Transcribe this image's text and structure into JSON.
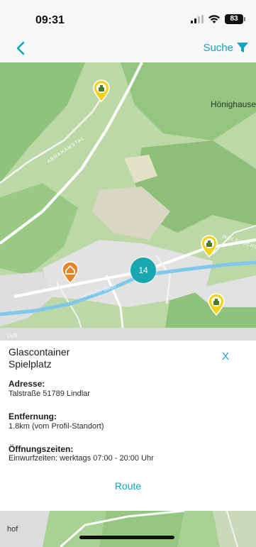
{
  "status_bar": {
    "time": "09:31",
    "battery": "83"
  },
  "nav": {
    "search_label": "Suche",
    "back_icon": "chevron-left-icon",
    "filter_icon": "funnel-icon",
    "accent_color": "#12a6c1"
  },
  "map": {
    "place_label": "Hönighause",
    "road_abrahamstal": "ABRAHAMSTAL",
    "road_wolfsschl": "WOLFSSCHL",
    "river_label": "Lennefer Bach",
    "lvr_label": "LVR",
    "cluster_count": "14",
    "cluster_color": "#1aa7b0",
    "marker_color": "#f2d21a",
    "home_marker_color": "#e8832a"
  },
  "detail": {
    "title_line1": "Glascontainer",
    "title_line2": "Spielplatz",
    "close_label": "X",
    "address_label": "Adresse:",
    "address_value": "Talstraße  51789 Lindlar",
    "distance_label": "Entfernung:",
    "distance_value": "1.8km (vom Profil-Standort)",
    "hours_label": "Öffnungszeiten:",
    "hours_value": "Einwurfzeiten: werktags 07:00 - 20:00 Uhr",
    "route_label": "Route"
  },
  "map_bottom": {
    "left_label": "hof"
  }
}
